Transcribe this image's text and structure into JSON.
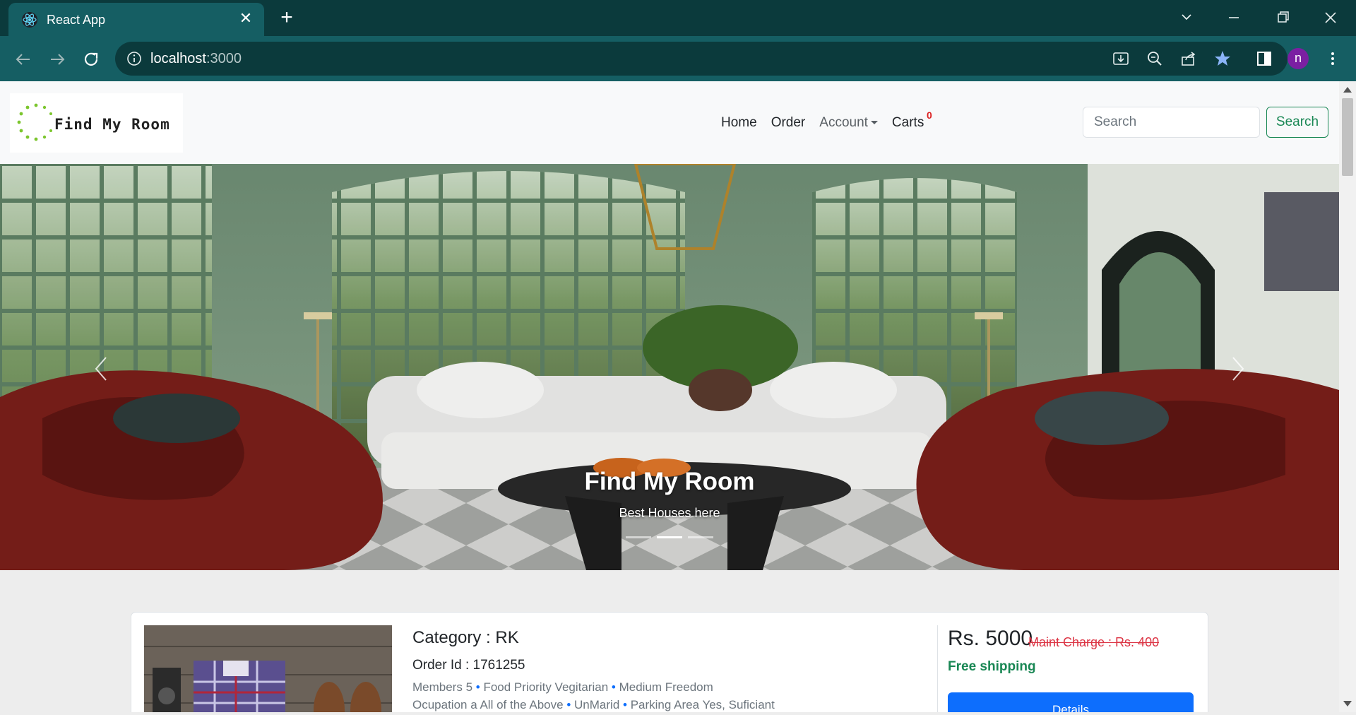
{
  "browser": {
    "tab_title": "React App",
    "url_host": "localhost",
    "url_port": ":3000",
    "profile_initial": "n"
  },
  "navbar": {
    "brand_text": "Find My Room",
    "links": [
      "Home",
      "Order",
      "Account",
      "Carts"
    ],
    "cart_count": "0",
    "search_placeholder": "Search",
    "search_button": "Search"
  },
  "carousel": {
    "caption_title": "Find My Room",
    "caption_subtitle": "Best Houses here",
    "slide_count": 3,
    "active_slide": 2
  },
  "card": {
    "category": "Category : RK",
    "order_id": "Order Id : 1761255",
    "members": "Members 5",
    "food": "Food Priority Vegitarian",
    "freedom": "Medium Freedom",
    "occupation": "Ocupation a All of the Above",
    "marital": "UnMarid",
    "parking": "Parking Area Yes, Suficiant",
    "price": "Rs. 5000",
    "maint_charge": "Maint Charge : Rs. 400",
    "shipping": "Free shipping",
    "details_button": "Details"
  },
  "colors": {
    "tab_bar": "#0b3a3c",
    "toolbar": "#155e63",
    "success": "#198754",
    "primary": "#0d6efd",
    "danger": "#dc3545"
  }
}
